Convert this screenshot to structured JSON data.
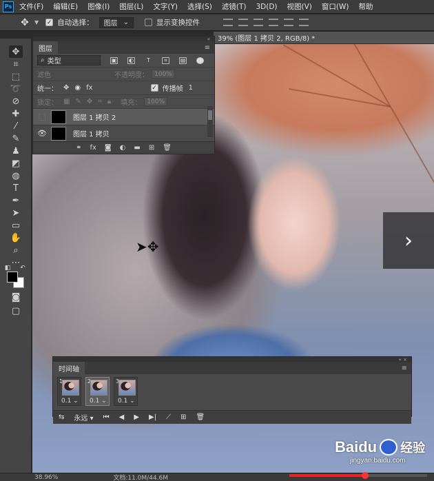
{
  "app": {
    "logo": "Ps"
  },
  "menu": [
    "文件(F)",
    "编辑(E)",
    "图像(I)",
    "图层(L)",
    "文字(Y)",
    "选择(S)",
    "滤镜(T)",
    "3D(D)",
    "视图(V)",
    "窗口(W)",
    "帮助"
  ],
  "options": {
    "auto_select_label": "自动选择：",
    "auto_select_target": "图层",
    "show_transform_label": "显示变换控件"
  },
  "document": {
    "tab_title": "39% (图层 1 拷贝 2, RGB/8) *"
  },
  "layers_panel": {
    "tab": "图层",
    "filter_kind": "类型",
    "blend_mode": "滤色",
    "opacity_label": "不透明度：",
    "opacity_value": "100%",
    "unify_label": "统一：",
    "propagate_label": "传播帧",
    "propagate_value": "1",
    "lock_label": "锁定：",
    "fill_label": "填充：",
    "fill_value": "100%",
    "layers": [
      {
        "name": "图层 1 拷贝 2",
        "visible": false,
        "selected": true
      },
      {
        "name": "图层 1 拷贝",
        "visible": true,
        "selected": false
      }
    ]
  },
  "timeline_panel": {
    "tab": "时间轴",
    "frames": [
      {
        "number": "1",
        "duration": "0.1"
      },
      {
        "number": "2",
        "duration": "0.1"
      },
      {
        "number": "3",
        "duration": "0.1"
      }
    ],
    "selected_frame": 2,
    "loop_option": "永远"
  },
  "status": {
    "zoom": "38.96%",
    "doc_size": "文档:11.0M/44.6M"
  },
  "video_progress": 0.55,
  "watermark": {
    "brand": "Baidu",
    "brand_cn": "经验",
    "url": "jingyan.baidu.com"
  }
}
